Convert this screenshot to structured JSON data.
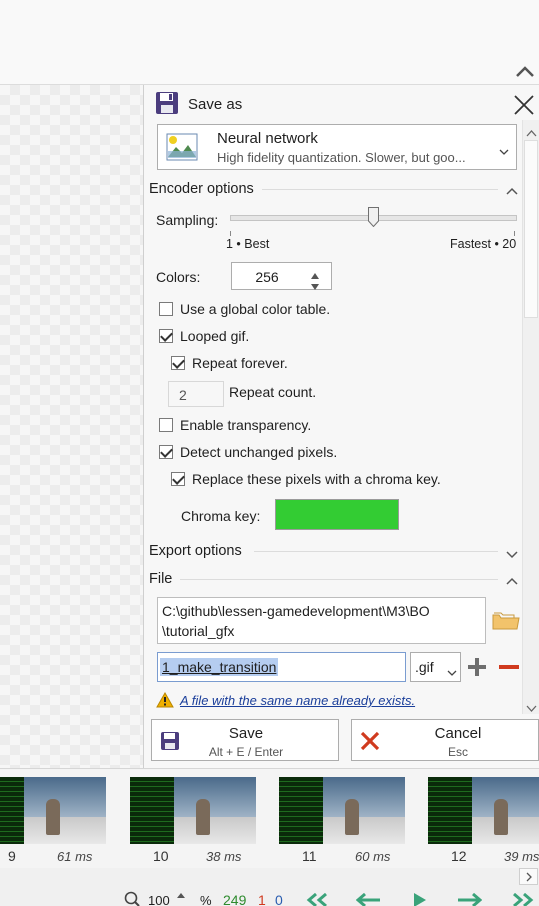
{
  "colors": {
    "accent": "#1a3e9a",
    "chroma_key": "#33cc33",
    "error_red": "#d03a1e",
    "warning": "#e0a300",
    "link": "#1a3e9a"
  },
  "panel": {
    "title": "Save as",
    "encoder": {
      "name": "Neural network",
      "description": "High fidelity quantization. Slower, but goo..."
    },
    "encoder_options": {
      "header": "Encoder options",
      "sampling_label": "Sampling:",
      "sampling_value": 0.5,
      "sampling_min_label": "1 • Best",
      "sampling_max_label": "Fastest • 20",
      "colors_label": "Colors:",
      "colors_value": "256",
      "global_color_table": {
        "label": "Use a global color table.",
        "checked": false
      },
      "looped_gif": {
        "label": "Looped gif.",
        "checked": true
      },
      "repeat_forever": {
        "label": "Repeat forever.",
        "checked": true
      },
      "repeat_count": {
        "value": "2",
        "label": "Repeat count."
      },
      "enable_transparency": {
        "label": "Enable transparency.",
        "checked": false
      },
      "detect_unchanged": {
        "label": "Detect unchanged pixels.",
        "checked": true
      },
      "replace_chroma": {
        "label": "Replace these pixels with a chroma key.",
        "checked": true
      },
      "chroma_key_label": "Chroma key:"
    },
    "export_options": {
      "header": "Export options"
    },
    "file": {
      "header": "File",
      "path_line1": "C:\\github\\lessen-gamedevelopment\\M3\\BO",
      "path_line2": "\\tutorial_gfx",
      "filename": "1_make_transition",
      "extension": ".gif",
      "warning": "A file with the same name already exists."
    },
    "save_button": {
      "label": "Save",
      "shortcut": "Alt + E / Enter"
    },
    "cancel_button": {
      "label": "Cancel",
      "shortcut": "Esc"
    }
  },
  "frames": [
    {
      "number": "9",
      "delay": "61 ms"
    },
    {
      "number": "10",
      "delay": "38 ms"
    },
    {
      "number": "11",
      "delay": "60 ms"
    },
    {
      "number": "12",
      "delay": "39 ms"
    }
  ],
  "status": {
    "zoom": "100",
    "zoom_unit": "%",
    "frame_count": "249",
    "selected_count": "1",
    "other_count": "0"
  }
}
